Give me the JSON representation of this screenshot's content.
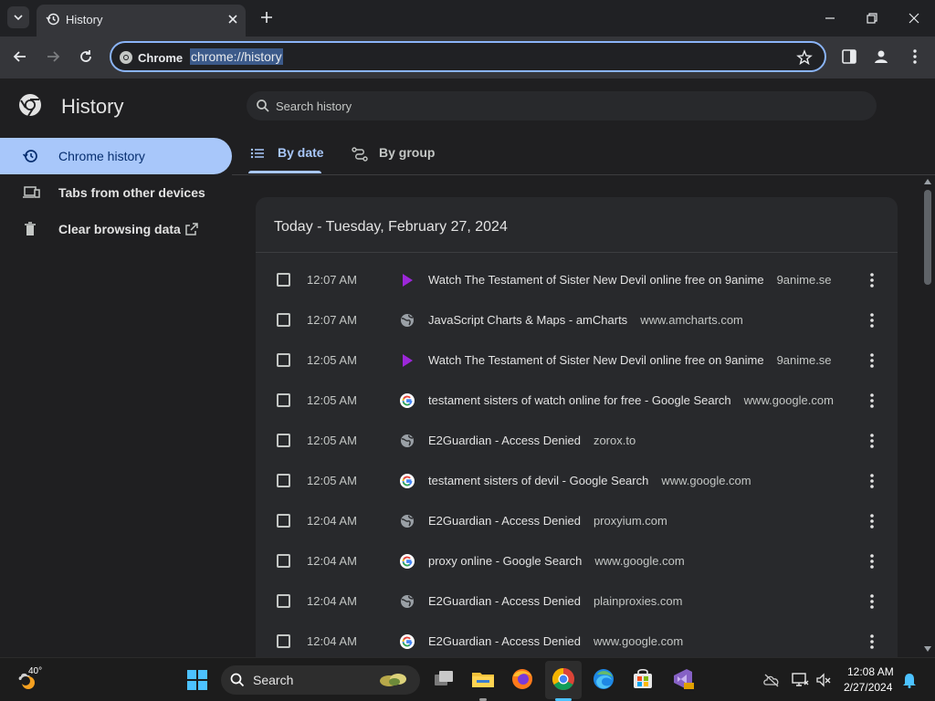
{
  "browser": {
    "tab_title": "History",
    "site_chip": "Chrome",
    "url": "chrome://history"
  },
  "page": {
    "title": "History",
    "search_placeholder": "Search history",
    "sidebar": [
      {
        "label": "Chrome history",
        "icon": "history-icon",
        "selected": true
      },
      {
        "label": "Tabs from other devices",
        "icon": "devices-icon",
        "selected": false
      },
      {
        "label": "Clear browsing data",
        "icon": "trash-icon",
        "selected": false
      }
    ],
    "tabs": [
      {
        "label": "By date",
        "selected": true
      },
      {
        "label": "By group",
        "selected": false
      }
    ],
    "day_header": "Today - Tuesday, February 27, 2024",
    "entries": [
      {
        "time": "12:07 AM",
        "title": "Watch The Testament of Sister New Devil online free on 9anime",
        "domain": "9anime.se",
        "favicon": "play-icon"
      },
      {
        "time": "12:07 AM",
        "title": "JavaScript Charts & Maps - amCharts",
        "domain": "www.amcharts.com",
        "favicon": "globe-icon"
      },
      {
        "time": "12:05 AM",
        "title": "Watch The Testament of Sister New Devil online free on 9anime",
        "domain": "9anime.se",
        "favicon": "play-icon"
      },
      {
        "time": "12:05 AM",
        "title": "testament sisters of watch online for free - Google Search",
        "domain": "www.google.com",
        "favicon": "google-icon"
      },
      {
        "time": "12:05 AM",
        "title": "E2Guardian - Access Denied",
        "domain": "zorox.to",
        "favicon": "globe-icon"
      },
      {
        "time": "12:05 AM",
        "title": "testament sisters of devil - Google Search",
        "domain": "www.google.com",
        "favicon": "google-icon"
      },
      {
        "time": "12:04 AM",
        "title": "E2Guardian - Access Denied",
        "domain": "proxyium.com",
        "favicon": "globe-icon"
      },
      {
        "time": "12:04 AM",
        "title": "proxy online - Google Search",
        "domain": "www.google.com",
        "favicon": "google-icon"
      },
      {
        "time": "12:04 AM",
        "title": "E2Guardian - Access Denied",
        "domain": "plainproxies.com",
        "favicon": "globe-icon"
      },
      {
        "time": "12:04 AM",
        "title": "E2Guardian - Access Denied",
        "domain": "www.google.com",
        "favicon": "google-icon"
      }
    ]
  },
  "taskbar": {
    "weather_temp": "40°",
    "search_label": "Search",
    "clock_time": "12:08 AM",
    "clock_date": "2/27/2024"
  },
  "colors": {
    "accent": "#a8c7fa",
    "page_bg": "#1f1f21",
    "card_bg": "#28292c",
    "play_purple": "#9c27d9"
  }
}
